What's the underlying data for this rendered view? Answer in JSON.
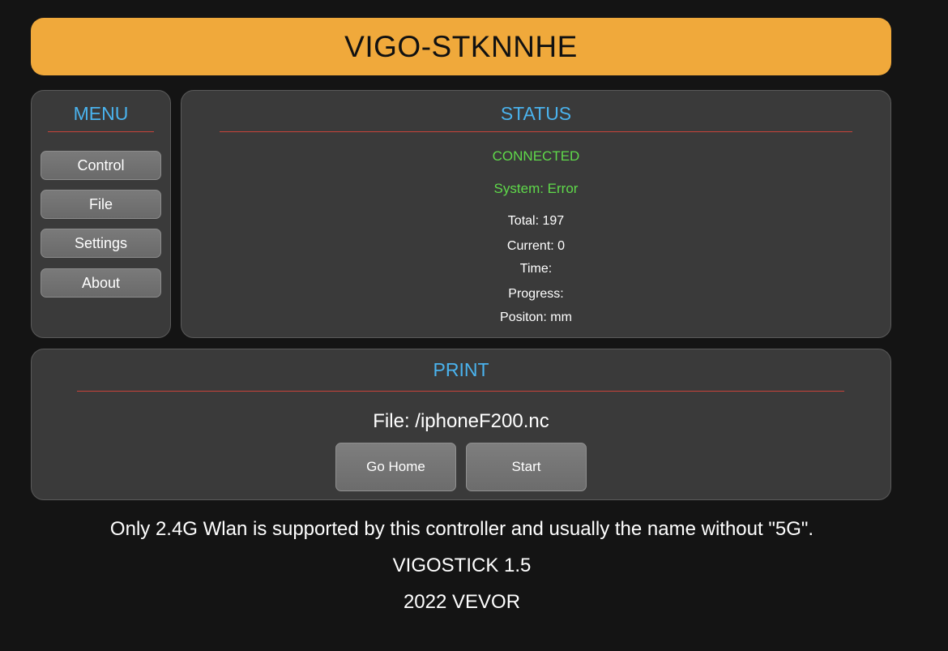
{
  "header": {
    "title": "VIGO-STKNNHE"
  },
  "menu": {
    "heading": "MENU",
    "items": [
      {
        "label": "Control"
      },
      {
        "label": "File"
      },
      {
        "label": "Settings"
      },
      {
        "label": "About"
      }
    ]
  },
  "status": {
    "heading": "STATUS",
    "connection": "CONNECTED",
    "system": "System: Error",
    "total": "Total: 197",
    "current": "Current: 0",
    "time": "Time:",
    "progress": "Progress:",
    "position": "Positon: mm"
  },
  "print": {
    "heading": "PRINT",
    "file": "File: /iphoneF200.nc",
    "go_home_label": "Go Home",
    "start_label": "Start"
  },
  "footer": {
    "notice": "Only 2.4G Wlan is supported by this controller and usually the name without \"5G\".",
    "version": "VIGOSTICK 1.5",
    "copyright": "2022 VEVOR"
  },
  "colors": {
    "background": "#141414",
    "title_bar": "#f0a93b",
    "heading": "#4ab3ee",
    "divider": "#c8433a",
    "status_ok": "#5fd94a",
    "panel": "#3a3a3a"
  }
}
